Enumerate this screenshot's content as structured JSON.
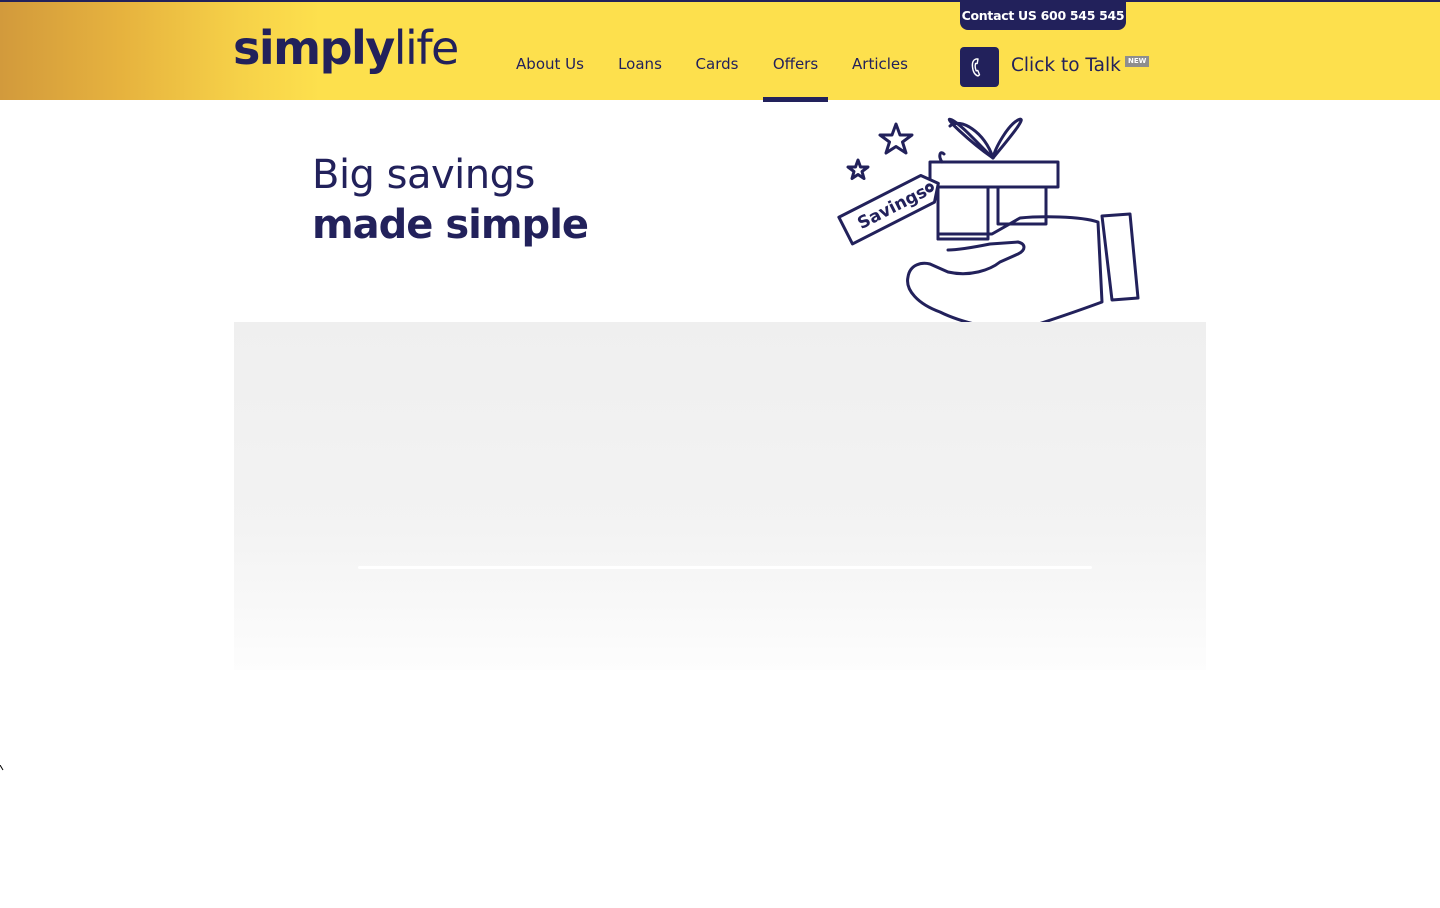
{
  "brand": {
    "logo_bold": "simply",
    "logo_light": "life"
  },
  "nav": {
    "items": [
      {
        "label": "About Us"
      },
      {
        "label": "Loans"
      },
      {
        "label": "Cards"
      },
      {
        "label": "Offers",
        "active": true
      },
      {
        "label": "Articles"
      }
    ]
  },
  "contact": {
    "pill_label": "Contact US 600 545 545",
    "talk_label": "Click to Talk",
    "new_badge": "NEW",
    "icon": "phone-icon"
  },
  "hero": {
    "line1": "Big savings",
    "line2": "made simple",
    "illustration": {
      "icon": "gift-on-hand-illustration",
      "tag_label": "Savings"
    }
  },
  "colors": {
    "navy": "#22215b",
    "yellow": "#fde04d",
    "gold": "#d29a3c",
    "panel_grey": "#efefef",
    "badge_grey": "#8e8e8e"
  }
}
